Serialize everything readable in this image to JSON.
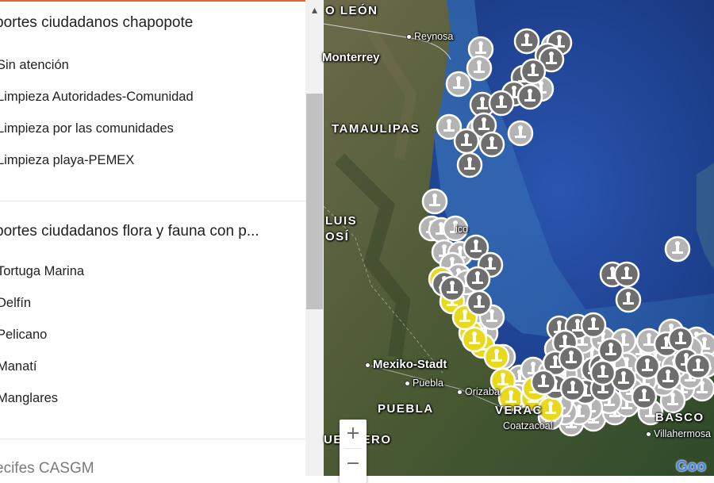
{
  "legend": {
    "sections": [
      {
        "title": "portes ciudadanos chapopote",
        "items": [
          "Sin atención",
          "Limpieza Autoridades-Comunidad",
          "Limpieza por las comunidades",
          "Limpieza playa-PEMEX"
        ]
      },
      {
        "title": "portes ciudadanos flora y fauna con p...",
        "items": [
          "Tortuga Marina",
          "Delfín",
          "Pelicano",
          "Manatí",
          "Manglares"
        ]
      },
      {
        "title": "ecifes CASGM",
        "items": []
      }
    ]
  },
  "scrollbar": {
    "up_icon": "▴"
  },
  "map": {
    "labels": {
      "nuevo_leon": "O LEÓN",
      "reynosa": "Reynosa",
      "monterrey": "Monterrey",
      "tamaulipas": "TAMAULIPAS",
      "luis": "LUIS",
      "potosi": "OSÍ",
      "mexico_frag": "ico",
      "mexiko_stadt": "Mexiko-Stadt",
      "puebla_city": "Puebla",
      "orizaba": "Orizaba",
      "puebla_state": "PUEBLA",
      "veracruz": "VERAC",
      "coatzacoalcos": "Coatzacoal",
      "tabasco": "BASCO",
      "villahermosa": "Villahermosa",
      "guerrero": "UERRERO"
    },
    "zoom_in": "+",
    "zoom_out": "−",
    "logo": "Goo"
  },
  "colors": {
    "accent": "#e1673a",
    "marker_dark": "#6e6e6e",
    "marker_light": "#b4b4b4",
    "marker_yellow": "#e8d81e",
    "ocean": "#1d3f8c",
    "land": "#4f5a3a"
  },
  "markers": {
    "dark": [
      [
        664,
        52
      ],
      [
        705,
        54
      ],
      [
        690,
        70
      ],
      [
        695,
        75
      ],
      [
        660,
        98
      ],
      [
        672,
        90
      ],
      [
        648,
        118
      ],
      [
        668,
        122
      ],
      [
        608,
        132
      ],
      [
        632,
        130
      ],
      [
        610,
        158
      ],
      [
        620,
        182
      ],
      [
        588,
        178
      ],
      [
        592,
        208
      ],
      [
        600,
        312
      ],
      [
        618,
        334
      ],
      [
        602,
        352
      ],
      [
        560,
        358
      ],
      [
        570,
        364
      ],
      [
        604,
        382
      ],
      [
        772,
        346
      ],
      [
        790,
        346
      ],
      [
        792,
        378
      ],
      [
        705,
        414
      ],
      [
        728,
        412
      ],
      [
        748,
        410
      ],
      [
        712,
        432
      ],
      [
        700,
        458
      ],
      [
        720,
        452
      ],
      [
        748,
        466
      ],
      [
        758,
        462
      ],
      [
        770,
        442
      ],
      [
        738,
        494
      ],
      [
        700,
        488
      ],
      [
        685,
        482
      ],
      [
        722,
        490
      ],
      [
        760,
        490
      ],
      [
        816,
        462
      ],
      [
        840,
        434
      ],
      [
        858,
        428
      ],
      [
        865,
        455
      ],
      [
        880,
        462
      ],
      [
        786,
        478
      ],
      [
        812,
        500
      ],
      [
        842,
        476
      ],
      [
        760,
        470
      ]
    ],
    "light": [
      [
        606,
        62
      ],
      [
        698,
        58
      ],
      [
        604,
        86
      ],
      [
        578,
        106
      ],
      [
        682,
        112
      ],
      [
        566,
        160
      ],
      [
        604,
        164
      ],
      [
        656,
        168
      ],
      [
        548,
        254
      ],
      [
        544,
        288
      ],
      [
        556,
        290
      ],
      [
        574,
        288
      ],
      [
        560,
        318
      ],
      [
        580,
        320
      ],
      [
        570,
        334
      ],
      [
        578,
        348
      ],
      [
        584,
        370
      ],
      [
        600,
        396
      ],
      [
        610,
        410
      ],
      [
        612,
        420
      ],
      [
        634,
        450
      ],
      [
        655,
        476
      ],
      [
        672,
        466
      ],
      [
        684,
        500
      ],
      [
        720,
        534
      ],
      [
        748,
        528
      ],
      [
        775,
        520
      ],
      [
        790,
        510
      ],
      [
        820,
        520
      ],
      [
        854,
        314
      ],
      [
        878,
        428
      ],
      [
        888,
        435
      ],
      [
        890,
        460
      ],
      [
        885,
        490
      ],
      [
        860,
        490
      ],
      [
        848,
        505
      ],
      [
        836,
        484
      ],
      [
        812,
        480
      ],
      [
        796,
        492
      ],
      [
        768,
        506
      ],
      [
        744,
        514
      ],
      [
        730,
        520
      ],
      [
        712,
        520
      ],
      [
        706,
        510
      ],
      [
        694,
        526
      ],
      [
        652,
        500
      ],
      [
        722,
        468
      ],
      [
        702,
        440
      ],
      [
        730,
        446
      ],
      [
        746,
        448
      ],
      [
        808,
        442
      ],
      [
        826,
        452
      ],
      [
        870,
        475
      ],
      [
        850,
        462
      ],
      [
        790,
        460
      ],
      [
        774,
        460
      ],
      [
        740,
        470
      ],
      [
        712,
        472
      ],
      [
        694,
        470
      ],
      [
        734,
        430
      ],
      [
        846,
        418
      ],
      [
        870,
        440
      ],
      [
        818,
        430
      ],
      [
        760,
        428
      ],
      [
        786,
        430
      ],
      [
        620,
        400
      ],
      [
        594,
        378
      ],
      [
        588,
        356
      ]
    ],
    "yellow": [
      [
        556,
        352
      ],
      [
        570,
        380
      ],
      [
        594,
        420
      ],
      [
        608,
        436
      ],
      [
        626,
        450
      ],
      [
        634,
        480
      ],
      [
        644,
        502
      ],
      [
        672,
        502
      ],
      [
        694,
        516
      ],
      [
        674,
        490
      ],
      [
        586,
        400
      ],
      [
        598,
        428
      ]
    ]
  }
}
